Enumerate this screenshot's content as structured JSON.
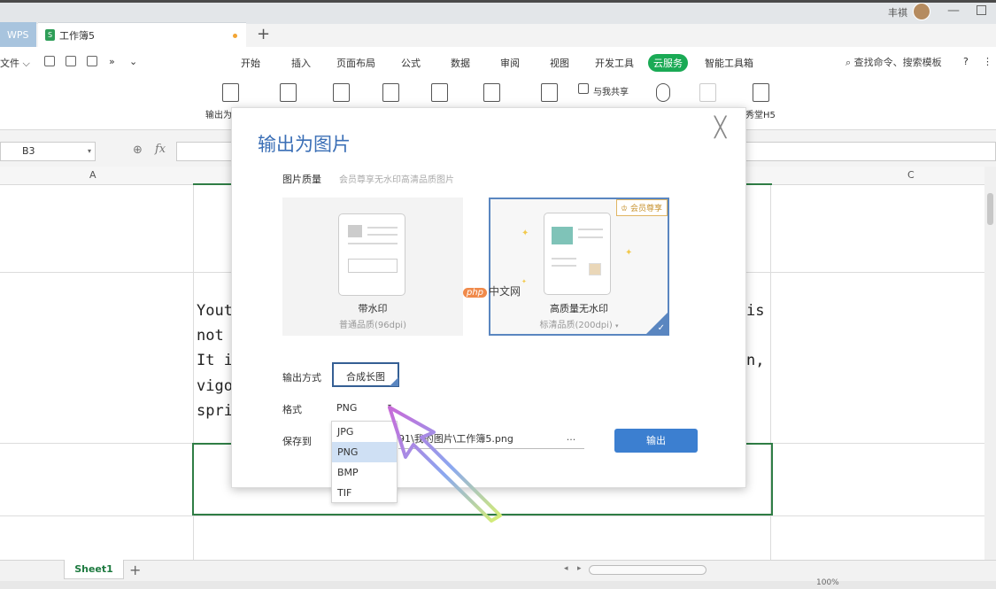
{
  "titlebar": {
    "wps_tab": "WPS",
    "book_tab": "工作簿5",
    "add_tab": "+",
    "user_name": "丰祺"
  },
  "menu": {
    "file": "文件",
    "items": [
      "开始",
      "插入",
      "页面布局",
      "公式",
      "数据",
      "审阅",
      "视图",
      "开发工具",
      "云服务",
      "智能工具箱"
    ],
    "search": "查找命令、搜索模板",
    "help": "?"
  },
  "ribbon": {
    "output_label": "输出为",
    "share_label": "与我共享",
    "h5_label": "秀堂H5"
  },
  "formula_bar": {
    "cell_ref": "B3",
    "fx": "fx",
    "zoom_glyph": "⊕"
  },
  "grid": {
    "col_a": "A",
    "col_c": "C",
    "cell_lines_left": [
      "Yout",
      "not",
      "It i",
      "vigo",
      "spri"
    ],
    "cell_lines_right": [
      "is",
      "",
      "n,"
    ]
  },
  "dialog": {
    "title": "输出为图片",
    "close": "╳",
    "quality_label": "图片质量",
    "quality_hint": "会员尊享无水印高清品质图片",
    "card_normal": {
      "title": "带水印",
      "sub": "普通品质(96dpi)"
    },
    "card_hq": {
      "title": "高质量无水印",
      "sub": "标清品质(200dpi)",
      "badge": "会员尊享"
    },
    "mode_label": "输出方式",
    "mode_value": "合成长图",
    "format_label": "格式",
    "format_value": "PNG",
    "save_label": "保存到",
    "save_path": "91\\我的图片\\工作簿5.png",
    "browse": "...",
    "export": "输出",
    "format_options": [
      "JPG",
      "PNG",
      "BMP",
      "TIF"
    ]
  },
  "sheets": {
    "active": "Sheet1",
    "add": "+"
  },
  "status": {
    "zoom": "100%"
  },
  "watermark": {
    "logo": "php",
    "text": "中文网"
  },
  "colors": {
    "accent_blue": "#3c7fd0",
    "sheet_green": "#2f7d45",
    "cloud_green": "#1aaa55"
  }
}
